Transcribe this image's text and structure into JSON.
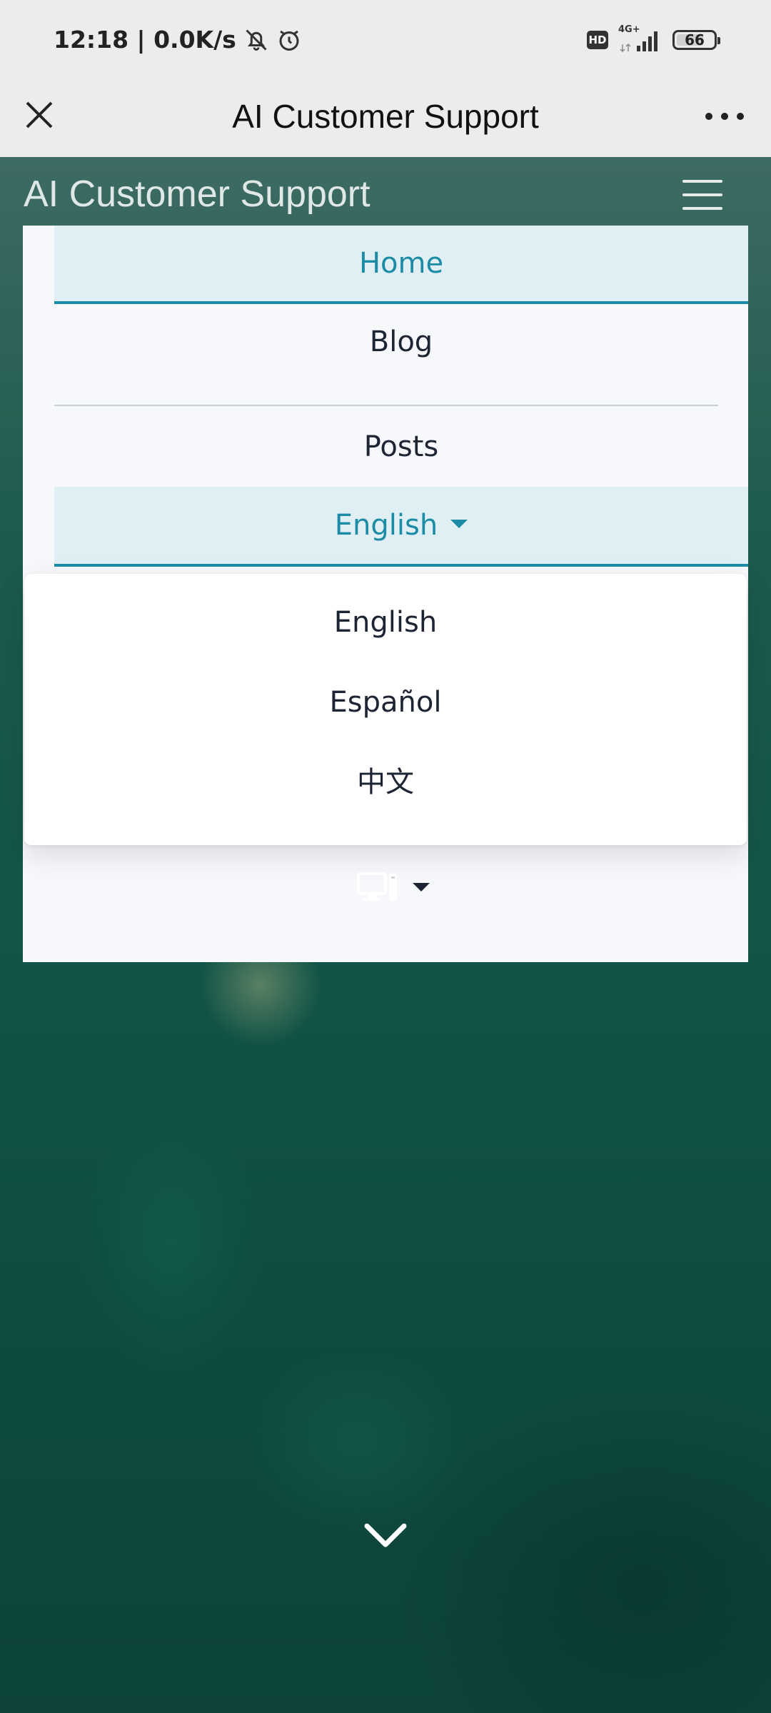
{
  "status_bar": {
    "time_net": "12:18 | 0.0K/s",
    "hd_label": "HD",
    "network_label": "4G+",
    "battery_level": "66"
  },
  "browser": {
    "title": "AI Customer Support"
  },
  "site": {
    "title": "AI Customer Support"
  },
  "nav": {
    "home": "Home",
    "blog": "Blog",
    "posts": "Posts",
    "language": "English"
  },
  "language_menu": {
    "options": [
      "English",
      "Español",
      "中文"
    ]
  },
  "colors": {
    "accent": "#1b8ba6",
    "status_bar_bg": "#ececec",
    "page_bg": "#135548"
  },
  "icons": {
    "close": "close-icon",
    "more": "more-icon",
    "menu": "hamburger-icon",
    "theme": "desktop-icon",
    "scroll": "chevron-down-icon"
  }
}
